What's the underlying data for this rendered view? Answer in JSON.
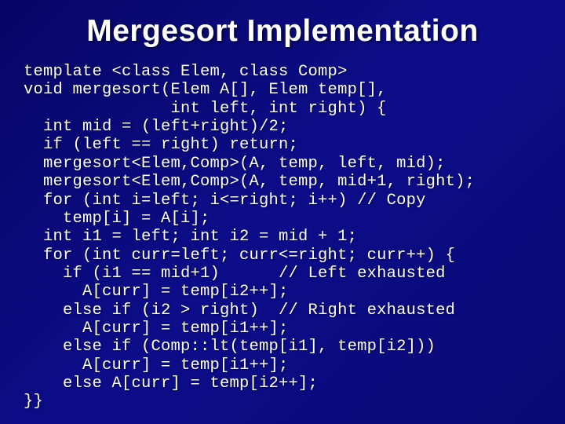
{
  "slide": {
    "title": "Mergesort Implementation",
    "code_lines": [
      "template <class Elem, class Comp>",
      "void mergesort(Elem A[], Elem temp[],",
      "               int left, int right) {",
      "  int mid = (left+right)/2;",
      "  if (left == right) return;",
      "  mergesort<Elem,Comp>(A, temp, left, mid);",
      "  mergesort<Elem,Comp>(A, temp, mid+1, right);",
      "  for (int i=left; i<=right; i++) // Copy",
      "    temp[i] = A[i];",
      "  int i1 = left; int i2 = mid + 1;",
      "  for (int curr=left; curr<=right; curr++) {",
      "    if (i1 == mid+1)      // Left exhausted",
      "      A[curr] = temp[i2++];",
      "    else if (i2 > right)  // Right exhausted",
      "      A[curr] = temp[i1++];",
      "    else if (Comp::lt(temp[i1], temp[i2]))",
      "      A[curr] = temp[i1++];",
      "    else A[curr] = temp[i2++];",
      "}}"
    ]
  }
}
